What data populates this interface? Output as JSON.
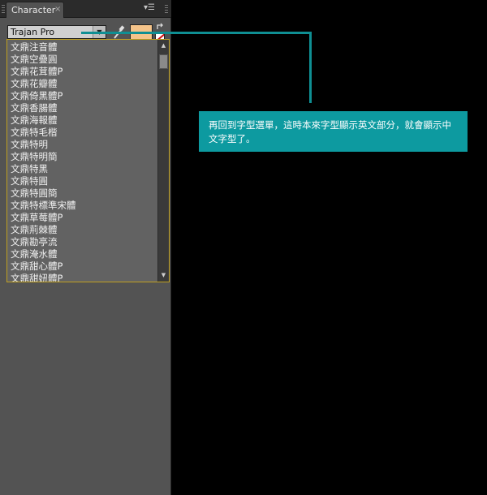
{
  "panel": {
    "tab_title": "Character",
    "tab_close": "×",
    "menu_icon": "▾☰",
    "font_family_value": "Trajan Pro",
    "fill_color": "#f5c48a",
    "stroke_color": "#ffffff"
  },
  "dropdown": {
    "items": [
      "文鼎注音體",
      "文鼎空疊圓",
      "文鼎花茸體P",
      "文鼎花瓣體",
      "文鼎倚黑體P",
      "文鼎香腸體",
      "文鼎海報體",
      "文鼎特毛楷",
      "文鼎特明",
      "文鼎特明簡",
      "文鼎特黑",
      "文鼎特圓",
      "文鼎特圓簡",
      "文鼎特標準宋體",
      "文鼎草莓體P",
      "文鼎荊棘體",
      "文鼎勘亭流",
      "文鼎淹水體",
      "文鼎甜心體P",
      "文鼎甜妞體P"
    ]
  },
  "callout": {
    "text": "再回到字型選單，這時本來字型顯示英文部分，就會顯示中文字型了。",
    "color": "#0d9aa0"
  }
}
